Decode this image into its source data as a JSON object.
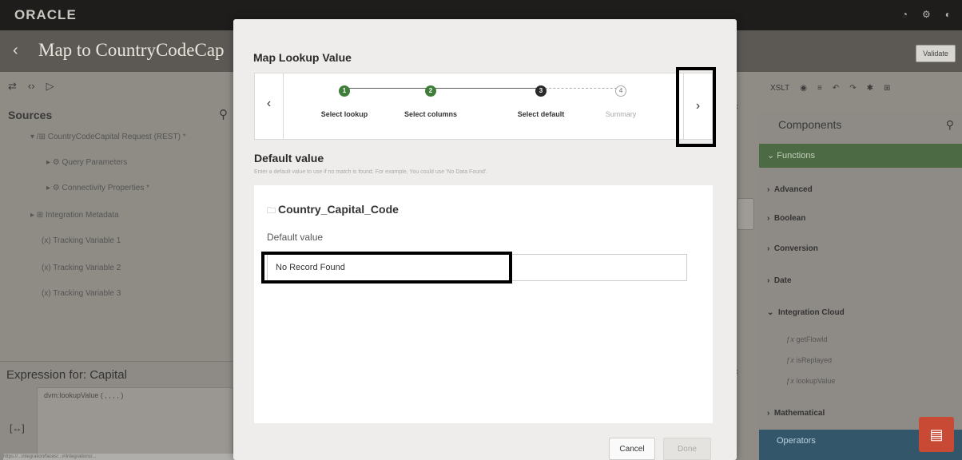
{
  "app": {
    "logo": "ORACLE",
    "title": "Map to CountryCodeCap",
    "validate_label": "Validate",
    "top_icons": [
      "bell-icon",
      "gear-icon",
      "user-icon"
    ]
  },
  "sources": {
    "title": "Sources",
    "tree": [
      {
        "label": "CountryCodeCapital Request (REST) *",
        "prefix": "▾ /⊞ "
      },
      {
        "label": "Query Parameters",
        "prefix": "▸ ⚙ "
      },
      {
        "label": "Connectivity Properties *",
        "prefix": "▸ ⚙ "
      },
      {
        "label": "Integration Metadata",
        "prefix": "▸ ⊞ "
      },
      {
        "label": "Tracking Variable 1",
        "prefix": "(x) "
      },
      {
        "label": "Tracking Variable 2",
        "prefix": "(x) "
      },
      {
        "label": "Tracking Variable 3",
        "prefix": "(x) "
      }
    ]
  },
  "expression": {
    "title": "Expression for: Capital",
    "text": "dvm:lookupValue ( , , , , )",
    "icon": "[↔]"
  },
  "status_url": "https://...integration/faces/...#/integrations/...",
  "components": {
    "title": "Components",
    "functions_label": "Functions",
    "items": [
      "Advanced",
      "Boolean",
      "Conversion",
      "Date",
      "Integration Cloud",
      "Mathematical"
    ],
    "sub_items": [
      "getFlowId",
      "isReplayed",
      "lookupValue"
    ],
    "operators_label": "Operators",
    "toolbar_label": "XSLT"
  },
  "modal": {
    "title": "Map Lookup Value",
    "steps": [
      {
        "number": "1",
        "label": "Select lookup",
        "state": "done"
      },
      {
        "number": "2",
        "label": "Select columns",
        "state": "done"
      },
      {
        "number": "3",
        "label": "Select default",
        "state": "current"
      },
      {
        "number": "4",
        "label": "Summary",
        "state": "todo"
      }
    ],
    "prev_label": "‹",
    "next_label": "›",
    "section_heading": "Default value",
    "section_hint": "Enter a default value to use if no match is found. For example, You could use 'No Data Found'.",
    "field_title": "Country_Capital_Code",
    "field_label": "Default value",
    "field_value": "No Record Found",
    "cancel_label": "Cancel",
    "done_label": "Done"
  }
}
